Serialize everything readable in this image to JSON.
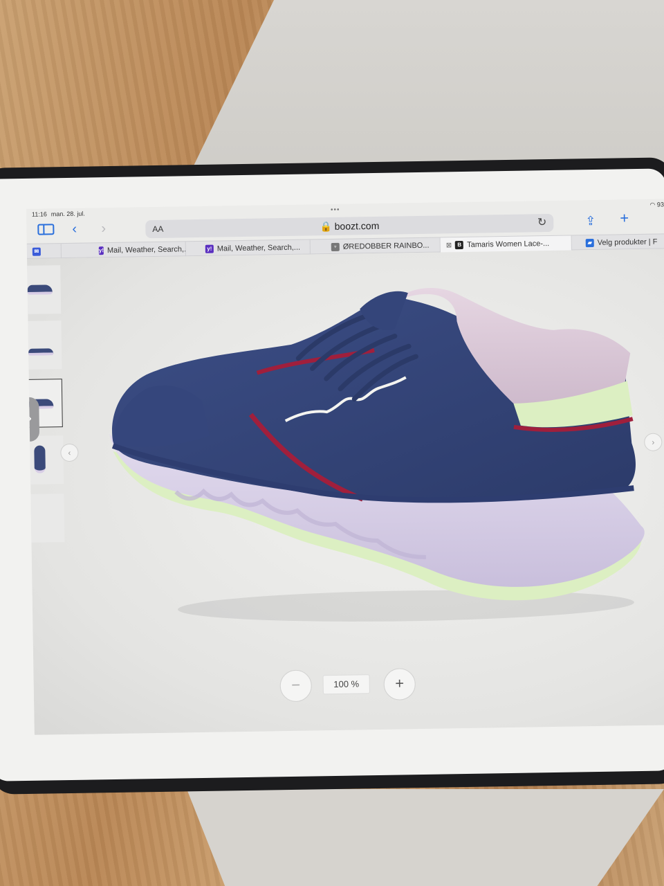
{
  "status_bar": {
    "time": "11:16",
    "date": "man. 28. jul.",
    "battery": "93"
  },
  "toolbar": {
    "text_size_label": "AA",
    "url": "boozt.com"
  },
  "tabs": [
    {
      "label": "",
      "icon": "mail-icon",
      "color": "#3a5bd9"
    },
    {
      "label": "Mail, Weather, Search,...",
      "icon": "yahoo-icon",
      "color": "#5a2fc0"
    },
    {
      "label": "Mail, Weather, Search,...",
      "icon": "yahoo-icon",
      "color": "#5a2fc0"
    },
    {
      "label": "ØREDOBBER RAINBO...",
      "icon": "store-icon",
      "color": "#555555"
    },
    {
      "label": "Tamaris Women Lace-...",
      "icon": "boozt-icon",
      "color": "#222222",
      "active": true
    },
    {
      "label": "Velg produkter | F",
      "icon": "folder-icon",
      "color": "#2a6fdc"
    }
  ],
  "viewer": {
    "zoom_level": "100 %",
    "zoom_in_label": "+",
    "zoom_out_label": "−",
    "prev_arrow": "‹",
    "next_arrow": "›",
    "side_arrow": "›"
  },
  "colors": {
    "accent": "#2a6fdc",
    "shoe_upper": "#34457a",
    "shoe_sole": "#d9d0e6",
    "shoe_trim": "#a01f3c",
    "shoe_heel": "#e1d0dd",
    "shoe_accent_green": "#dcefc2"
  }
}
